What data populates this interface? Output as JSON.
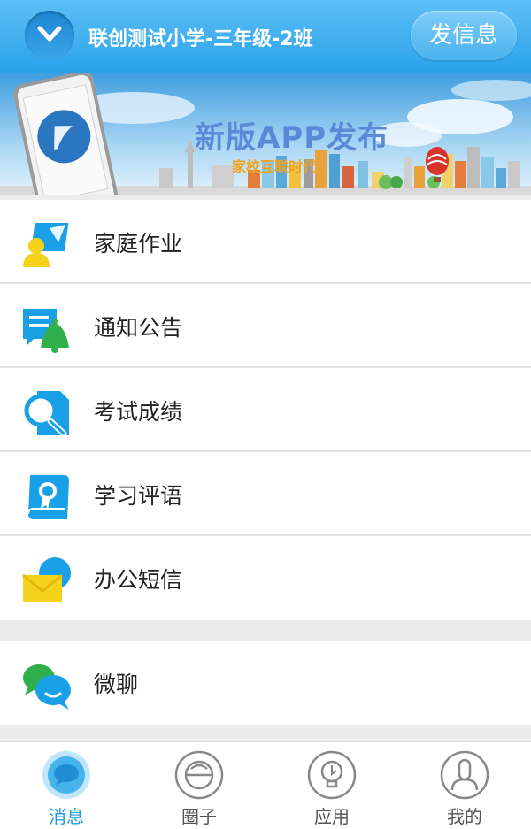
{
  "header": {
    "dropdown_icon": "chevron-down-icon",
    "title": "联创测试小学-三年级-2班",
    "send_button": "发信息"
  },
  "banner": {
    "headline": "新版APP发布",
    "subheadline": "家校互联时代"
  },
  "menu": {
    "items": [
      {
        "label": "家庭作业",
        "icon": "homework-icon"
      },
      {
        "label": "通知公告",
        "icon": "notice-bell-icon"
      },
      {
        "label": "考试成绩",
        "icon": "exam-search-icon"
      },
      {
        "label": "学习评语",
        "icon": "certificate-scroll-icon"
      },
      {
        "label": "办公短信",
        "icon": "envelope-icon"
      }
    ],
    "chat_item": {
      "label": "微聊",
      "icon": "chat-bubbles-icon"
    }
  },
  "tabbar": {
    "tabs": [
      {
        "label": "消息",
        "icon": "message-icon",
        "active": true
      },
      {
        "label": "圈子",
        "icon": "circle-icon",
        "active": false
      },
      {
        "label": "应用",
        "icon": "lightbulb-icon",
        "active": false
      },
      {
        "label": "我的",
        "icon": "person-icon",
        "active": false
      }
    ]
  },
  "colors": {
    "header_blue": "#2aa2ea",
    "active_tab": "#1e9be3",
    "icon_blue": "#1aa0e6",
    "icon_yellow": "#f5d21c",
    "icon_green": "#2fb04a"
  }
}
